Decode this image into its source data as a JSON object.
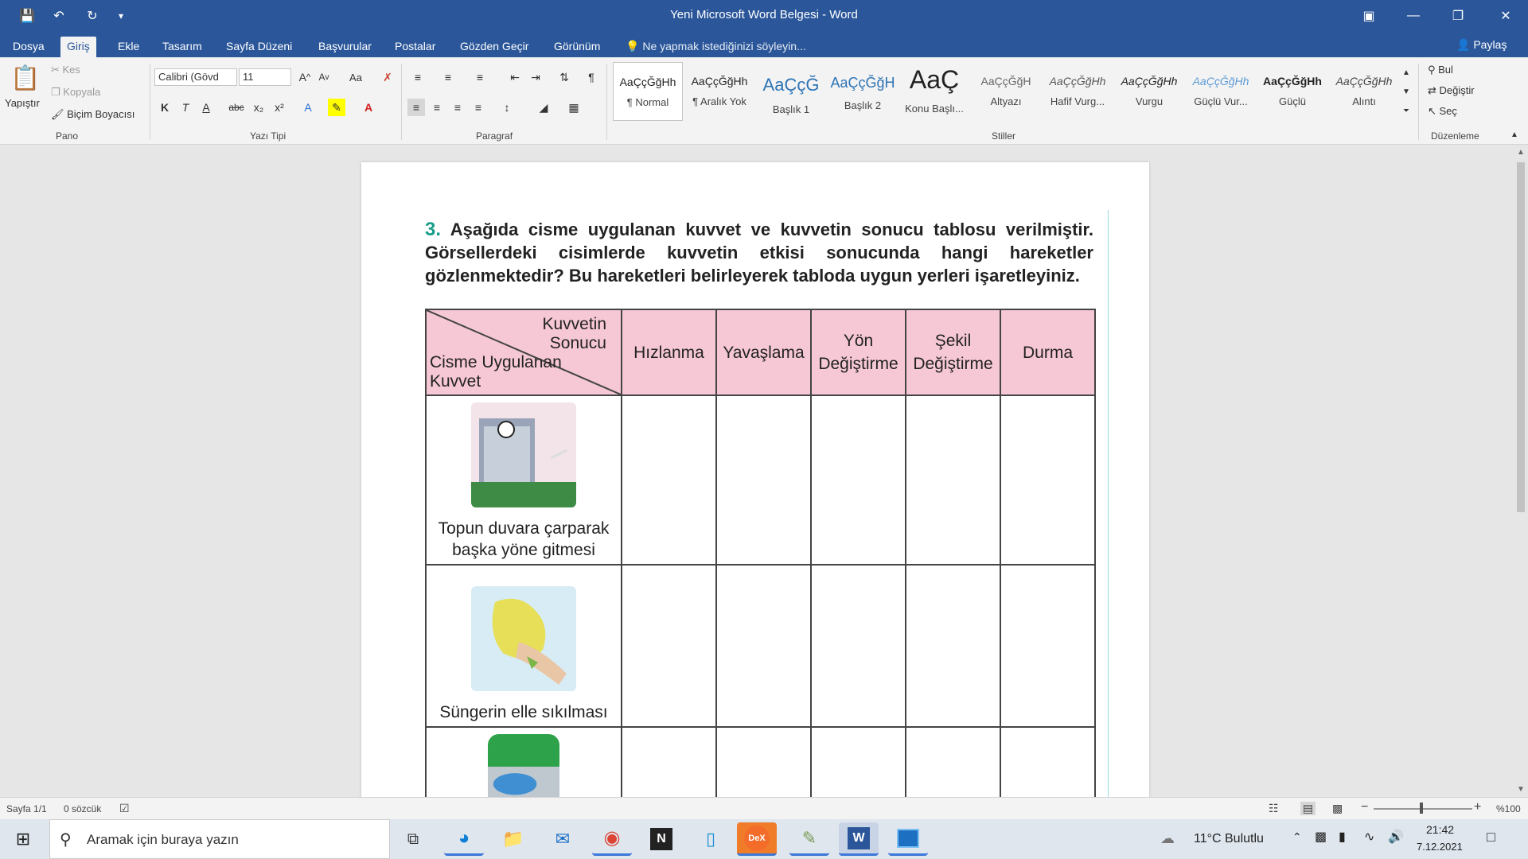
{
  "titlebar": {
    "title": "Yeni Microsoft Word Belgesi - Word",
    "share_label": "Paylaş"
  },
  "tabs": [
    "Dosya",
    "Giriş",
    "Ekle",
    "Tasarım",
    "Sayfa Düzeni",
    "Başvurular",
    "Postalar",
    "Gözden Geçir",
    "Görünüm"
  ],
  "active_tab": "Giriş",
  "tell_me": "Ne yapmak istediğinizi söyleyin...",
  "ribbon": {
    "clipboard": {
      "paste": "Yapıştır",
      "cut": "Kes",
      "copy": "Kopyala",
      "format_painter": "Biçim Boyacısı",
      "label": "Pano"
    },
    "font": {
      "name": "Calibri (Gövd",
      "size": "11",
      "bold": "K",
      "italic": "T",
      "underline": "A",
      "strike": "abc",
      "sub": "x₂",
      "sup": "x²",
      "case": "Aa",
      "label": "Yazı Tipi"
    },
    "paragraph": {
      "label": "Paragraf"
    },
    "styles": {
      "items": [
        {
          "sample": "AaÇçĞğHh",
          "name": "¶ Normal"
        },
        {
          "sample": "AaÇçĞğHh",
          "name": "¶ Aralık Yok"
        },
        {
          "sample": "AaÇçĞ",
          "name": "Başlık 1"
        },
        {
          "sample": "AaÇçĞğH",
          "name": "Başlık 2"
        },
        {
          "sample": "AaÇ",
          "name": "Konu Başlı..."
        },
        {
          "sample": "AaÇçĞğH",
          "name": "Altyazı"
        },
        {
          "sample": "AaÇçĞğHh",
          "name": "Hafif Vurg..."
        },
        {
          "sample": "AaÇçĞğHh",
          "name": "Vurgu"
        },
        {
          "sample": "AaÇçĞğHh",
          "name": "Güçlü Vur..."
        },
        {
          "sample": "AaÇçĞğHh",
          "name": "Güçlü"
        },
        {
          "sample": "AaÇçĞğHh",
          "name": "Alıntı"
        }
      ],
      "label": "Stiller"
    },
    "editing": {
      "find": "Bul",
      "replace": "Değiştir",
      "select": "Seç",
      "label": "Düzenleme"
    }
  },
  "document": {
    "question_number": "3.",
    "question_text": "Aşağıda cisme uygulanan kuvvet ve kuvvetin sonucu tablosu verilmiştir. Görsellerdeki cisimlerde kuvvetin etkisi sonucunda hangi hareketler gözlenmektedir? Bu hareketleri belirleyerek tabloda uygun yerleri işaretleyiniz.",
    "table": {
      "corner_top": "Kuvvetin Sonucu",
      "corner_bottom": "Cisme Uygulanan Kuvvet",
      "columns": [
        "Hızlanma",
        "Yavaşlama",
        "Yön Değiştirme",
        "Şekil Değiştirme",
        "Durma"
      ],
      "rows": [
        {
          "label": "Topun duvara çarparak başka yöne gitmesi"
        },
        {
          "label": "Süngerin elle sıkılması"
        },
        {
          "label": ""
        }
      ]
    }
  },
  "statusbar": {
    "page": "Sayfa 1/1",
    "words": "0 sözcük",
    "zoom": "%100"
  },
  "taskbar": {
    "search_placeholder": "Aramak için buraya yazın",
    "weather": "11°C  Bulutlu",
    "time": "21:42",
    "date": "7.12.2021"
  }
}
